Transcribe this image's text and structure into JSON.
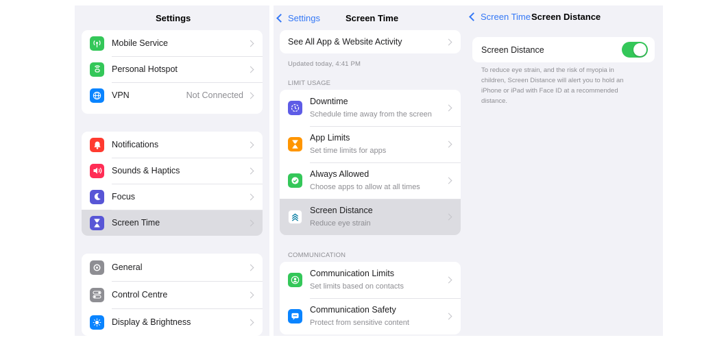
{
  "settings": {
    "title": "Settings",
    "group1": [
      {
        "label": "Mobile Service",
        "icon": "antenna-icon",
        "color": "#34c759"
      },
      {
        "label": "Personal Hotspot",
        "icon": "hotspot-icon",
        "color": "#34c759"
      },
      {
        "label": "VPN",
        "value": "Not Connected",
        "icon": "vpn-globe-icon",
        "color": "#0a84ff"
      }
    ],
    "group2": [
      {
        "label": "Notifications",
        "icon": "bell-icon",
        "color": "#ff3b30"
      },
      {
        "label": "Sounds & Haptics",
        "icon": "speaker-icon",
        "color": "#ff2d55"
      },
      {
        "label": "Focus",
        "icon": "moon-icon",
        "color": "#5856d6"
      },
      {
        "label": "Screen Time",
        "icon": "hourglass-icon",
        "color": "#5856d6"
      }
    ],
    "group3": [
      {
        "label": "General",
        "icon": "gear-icon",
        "color": "#8e8e93"
      },
      {
        "label": "Control Centre",
        "icon": "switches-icon",
        "color": "#8e8e93"
      },
      {
        "label": "Display & Brightness",
        "icon": "sun-icon",
        "color": "#0a84ff"
      }
    ]
  },
  "screen_time": {
    "back": "Settings",
    "title": "Screen Time",
    "activity": "See All App & Website Activity",
    "updated": "Updated today, 4:41 PM",
    "limit_header": "LIMIT USAGE",
    "limit_items": [
      {
        "label": "Downtime",
        "sub": "Schedule time away from the screen",
        "icon": "downtime-icon",
        "color": "#5e5ce6"
      },
      {
        "label": "App Limits",
        "sub": "Set time limits for apps",
        "icon": "hourglass-icon",
        "color": "#ff9500"
      },
      {
        "label": "Always Allowed",
        "sub": "Choose apps to allow at all times",
        "icon": "checkmark-icon",
        "color": "#34c759"
      },
      {
        "label": "Screen Distance",
        "sub": "Reduce eye strain",
        "icon": "screen-distance-icon",
        "color": "#ffffff"
      }
    ],
    "comm_header": "COMMUNICATION",
    "comm_items": [
      {
        "label": "Communication Limits",
        "sub": "Set limits based on contacts",
        "icon": "contact-icon",
        "color": "#34c759"
      },
      {
        "label": "Communication Safety",
        "sub": "Protect from sensitive content",
        "icon": "chat-bubble-icon",
        "color": "#0a84ff"
      }
    ]
  },
  "screen_distance": {
    "back": "Screen Time",
    "title": "Screen Distance",
    "toggle_label": "Screen Distance",
    "toggle_on": true,
    "note_lines": [
      "To reduce eye strain, and the risk of myopia in",
      "children, Screen Distance will alert you to hold an",
      "iPhone or iPad with Face ID at a recommended",
      "distance."
    ]
  },
  "colors": {
    "accent": "#3478f6",
    "toggle_on": "#34c759",
    "background": "#f2f2f7",
    "highlight": "#dcdce1"
  }
}
